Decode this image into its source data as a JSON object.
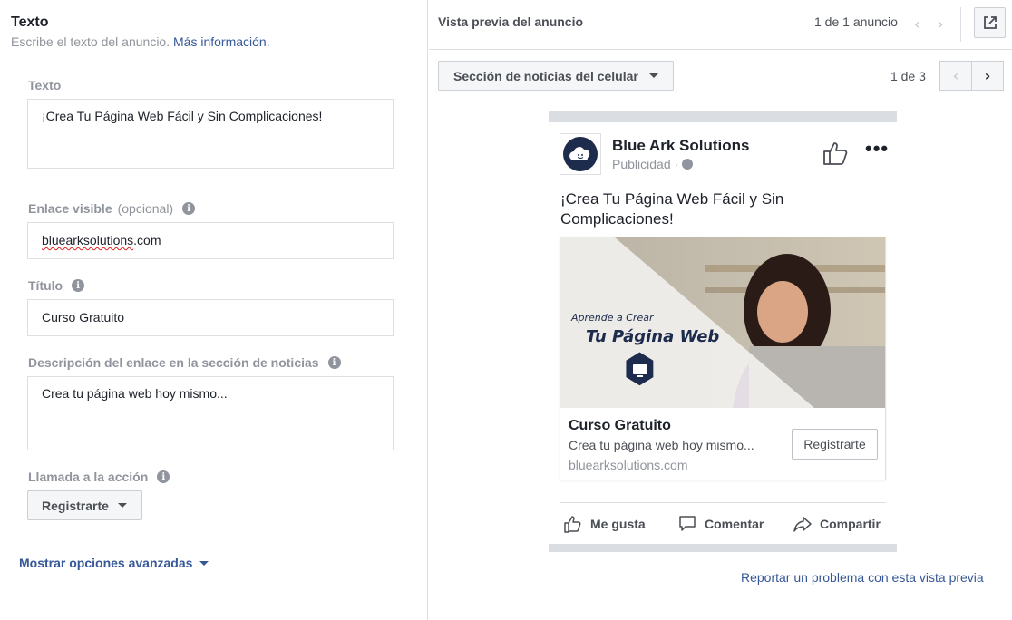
{
  "left": {
    "title": "Texto",
    "subtitle": "Escribe el texto del anuncio.",
    "more_info_link": "Más información.",
    "fields": {
      "text": {
        "label": "Texto",
        "value": "¡Crea Tu Página Web Fácil y Sin Complicaciones!"
      },
      "display_link": {
        "label": "Enlace visible",
        "optional": "(opcional)",
        "value_misspelled": "bluearksolutions",
        "value_suffix": ".com"
      },
      "headline": {
        "label": "Título",
        "value": "Curso Gratuito"
      },
      "news_feed_description": {
        "label": "Descripción del enlace en la sección de noticias",
        "value": "Crea tu página web hoy mismo..."
      },
      "call_to_action": {
        "label": "Llamada a la acción",
        "value": "Registrarte"
      }
    },
    "advanced_options": "Mostrar opciones avanzadas"
  },
  "preview": {
    "title": "Vista previa del anuncio",
    "ad_count": "1 de 1 anuncio",
    "placement": "Sección de noticias del celular",
    "page_count": "1 de 3",
    "report_link": "Reportar un problema con esta vista previa"
  },
  "ad": {
    "page_name": "Blue Ark Solutions",
    "sponsored": "Publicidad ·",
    "primary_text": "¡Crea Tu Página Web Fácil y Sin Complicaciones!",
    "image_overlay": {
      "line1": "Aprende a Crear",
      "line2": "Tu Página Web"
    },
    "card": {
      "title": "Curso Gratuito",
      "description": "Crea tu página web hoy mismo...",
      "domain": "bluearksolutions.com",
      "button": "Registrarte"
    },
    "actions": {
      "like": "Me gusta",
      "comment": "Comentar",
      "share": "Compartir"
    }
  },
  "icons": {
    "info": "i",
    "prev": "‹",
    "next": "›"
  },
  "colors": {
    "link": "#365899",
    "muted": "#90949c",
    "brand_dark": "#1d2b4d"
  }
}
